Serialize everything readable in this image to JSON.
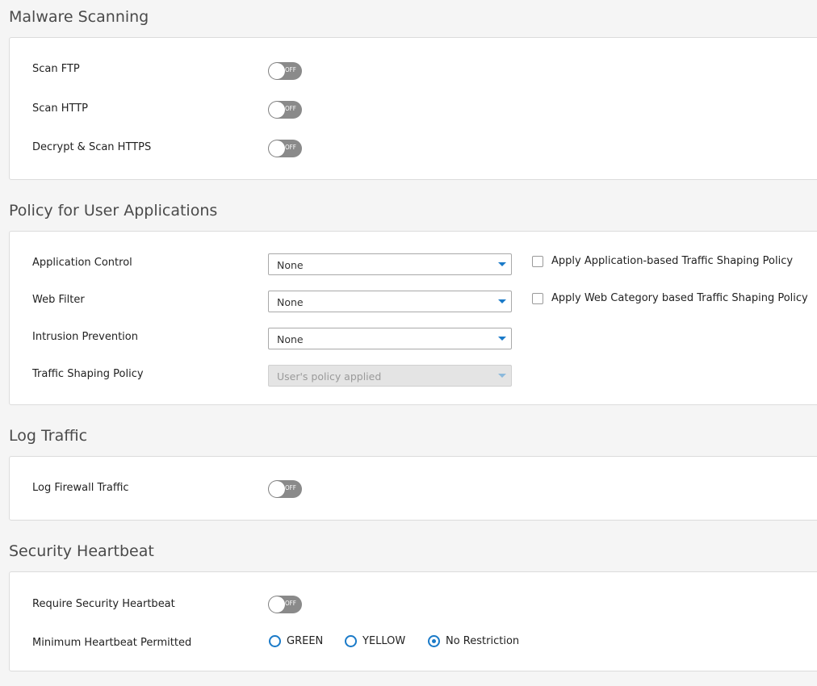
{
  "colors": {
    "accent": "#1a7ac8",
    "toggle_off": "#8a8a8a",
    "card_border": "#dcdcdc",
    "page_background": "#f5f5f5"
  },
  "malware_scanning": {
    "title": "Malware Scanning",
    "rows": [
      {
        "label": "Scan FTP",
        "state": "OFF"
      },
      {
        "label": "Scan HTTP",
        "state": "OFF"
      },
      {
        "label": "Decrypt & Scan HTTPS",
        "state": "OFF"
      }
    ]
  },
  "user_applications": {
    "title": "Policy for User Applications",
    "application_control": {
      "label": "Application Control",
      "value": "None"
    },
    "web_filter": {
      "label": "Web Filter",
      "value": "None"
    },
    "intrusion_prevention": {
      "label": "Intrusion Prevention",
      "value": "None"
    },
    "traffic_shaping": {
      "label": "Traffic Shaping Policy",
      "value": "User's policy applied",
      "disabled": true
    },
    "apply_app_shaping": {
      "label": "Apply Application-based Traffic Shaping Policy",
      "checked": false
    },
    "apply_web_shaping": {
      "label": "Apply Web Category based Traffic Shaping Policy",
      "checked": false
    }
  },
  "log_traffic": {
    "title": "Log Traffic",
    "log_firewall": {
      "label": "Log Firewall Traffic",
      "state": "OFF"
    }
  },
  "security_heartbeat": {
    "title": "Security Heartbeat",
    "require": {
      "label": "Require Security Heartbeat",
      "state": "OFF"
    },
    "minimum": {
      "label": "Minimum Heartbeat Permitted",
      "options": [
        "GREEN",
        "YELLOW",
        "No Restriction"
      ],
      "selected": "No Restriction"
    }
  },
  "icons": {
    "select_caret": "chevron-down-icon",
    "checkbox": "checkbox-icon",
    "radio": "radio-icon"
  }
}
